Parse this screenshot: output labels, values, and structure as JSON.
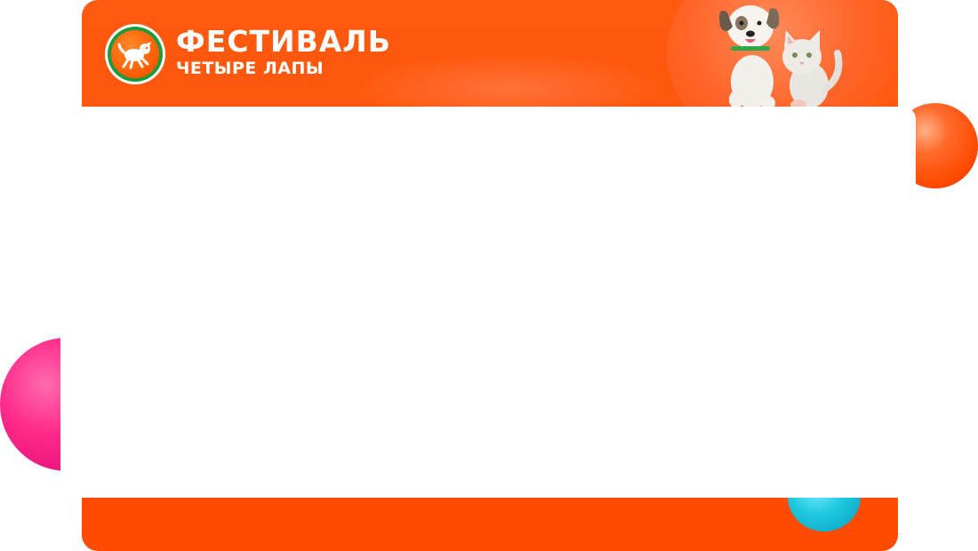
{
  "header": {
    "title": "ФЕСТИВАЛЬ",
    "subtitle": "ЧЕТЫРЕ ЛАПЫ",
    "logo_icon": "running-dog-logo-icon",
    "pets_icon": "dog-and-cat-illustration"
  },
  "colors": {
    "banner": "#ff4a00",
    "logo_ring": "#1f9a3b",
    "panel": "#ffffff",
    "ball_pink": "#ff2a8a",
    "ball_cyan": "#20c8e0",
    "ball_orange": "#ff6a2a"
  }
}
